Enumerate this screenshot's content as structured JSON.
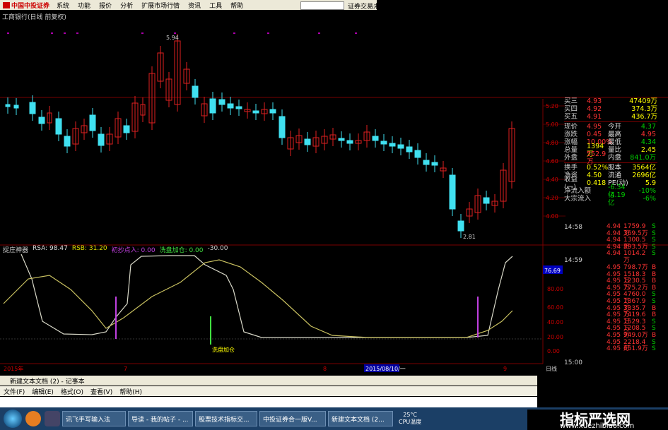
{
  "menubar": {
    "logo": "中国中投证券",
    "items": [
      "系统",
      "功能",
      "报价",
      "分析",
      "扩展市场行情",
      "资讯",
      "工具",
      "帮助"
    ],
    "right_text": "证券交易未登"
  },
  "chart_title": "工商银行(日线 前复权)",
  "price_axis": [
    "5.20",
    "5.00",
    "4.80",
    "4.60",
    "4.40",
    "4.20",
    "4.00"
  ],
  "price_labels": {
    "high": "5.94",
    "low": "2.81"
  },
  "quote": {
    "rows": [
      {
        "label": "买三",
        "val": "4.93",
        "extra": "47409万"
      },
      {
        "label": "买四",
        "val": "4.92",
        "extra": "374.3万"
      },
      {
        "label": "买五",
        "val": "4.91",
        "extra": "436.7万"
      },
      {
        "label": "现价",
        "val": "4.95",
        "k2": "今开",
        "v2": "4.37"
      },
      {
        "label": "涨跌",
        "val": "0.45",
        "k2": "最高",
        "v2": "4.95"
      },
      {
        "label": "涨幅",
        "val": "10.00%",
        "k2": "最低",
        "v2": "4.34"
      },
      {
        "label": "总量",
        "val": "1394万",
        "k2": "量比",
        "v2": "2.45"
      },
      {
        "label": "外盘",
        "val": "552.9万",
        "k2": "内盘",
        "v2": "841.0万"
      },
      {
        "label": "换手",
        "val": "0.52%",
        "k2": "股本",
        "v2": "3564亿"
      },
      {
        "label": "净资",
        "val": "4.50",
        "k2": "流通",
        "v2": "2696亿"
      },
      {
        "label": "收益(一)",
        "val": "0.418",
        "k2": "PE(动)",
        "v2": "5.9"
      },
      {
        "label": "净流入额",
        "val": "-6.34亿",
        "v2": "-10%"
      },
      {
        "label": "大宗流入",
        "val": "-4.19亿",
        "v2": "-6%"
      }
    ]
  },
  "ticks": {
    "times": [
      "14:58",
      "14:59",
      "15:00"
    ],
    "rows": [
      {
        "p": "4.94",
        "v": "1759.9万",
        "f": "S"
      },
      {
        "p": "4.94",
        "v": "369.5万",
        "f": "S"
      },
      {
        "p": "4.94",
        "v": "1300.5万",
        "f": "S"
      },
      {
        "p": "4.94",
        "v": "893.5万",
        "f": "S"
      },
      {
        "p": "4.94",
        "v": "1014.2万",
        "f": "S"
      },
      {
        "p": "4.95",
        "v": "798.7万",
        "f": "B"
      },
      {
        "p": "4.95",
        "v": "1518.3万",
        "f": "B"
      },
      {
        "p": "4.95",
        "v": "1230.5万",
        "f": "B"
      },
      {
        "p": "4.95",
        "v": "775.2万",
        "f": "B"
      },
      {
        "p": "4.95",
        "v": "4760.0万",
        "f": "S"
      },
      {
        "p": "4.95",
        "v": "1367.9万",
        "f": "S"
      },
      {
        "p": "4.95",
        "v": "3335.7万",
        "f": "B"
      },
      {
        "p": "4.95",
        "v": "7419.6万",
        "f": "B"
      },
      {
        "p": "4.95",
        "v": "1529.3万",
        "f": "S"
      },
      {
        "p": "4.95",
        "v": "1208.5万",
        "f": "S"
      },
      {
        "p": "4.95",
        "v": "949.0万",
        "f": "B"
      },
      {
        "p": "4.95",
        "v": "2218.4万",
        "f": "S"
      },
      {
        "p": "4.95",
        "v": "651.9万",
        "f": "S"
      }
    ]
  },
  "indicator": {
    "name": "捉庄神器",
    "rsa": "RSA: 98.47",
    "rsb": "RSB: 31.20",
    "sig1": "初抄点入: 0.00",
    "sig2": "洗盘加仓: 0.00",
    "val": "-30.00",
    "current": "76.69",
    "axis": [
      "80.00",
      "60.00",
      "40.00",
      "20.00",
      "0.00"
    ],
    "mark_label": "洗盘加仓"
  },
  "timeline": {
    "start": "2015年",
    "m7": "7",
    "m8": "8",
    "m9": "9",
    "date": "2015/08/10/一",
    "period": "日线"
  },
  "notepad": {
    "title": "新建文本文档 (2) - 记事本",
    "menu": [
      "文件(F)",
      "编辑(E)",
      "格式(O)",
      "查看(V)",
      "帮助(H)"
    ]
  },
  "taskbar": {
    "tasks": [
      "讯飞手写输入法",
      "导读 - 我的帖子 - ...",
      "股票技术指标交...",
      "中投证券合一版V...",
      "新建文本文档 (2..."
    ],
    "temp": "25°C",
    "cpu": "CPU温度"
  },
  "watermark": {
    "title": "指标严选网",
    "url": "www.xuezhibiao.com"
  },
  "colors": {
    "up": "#e02020",
    "down": "#40e0f0",
    "rsa": "#d8d8c8",
    "rsb": "#c8c060",
    "buy_mark": "#c040e0",
    "add_mark": "#40e040"
  }
}
